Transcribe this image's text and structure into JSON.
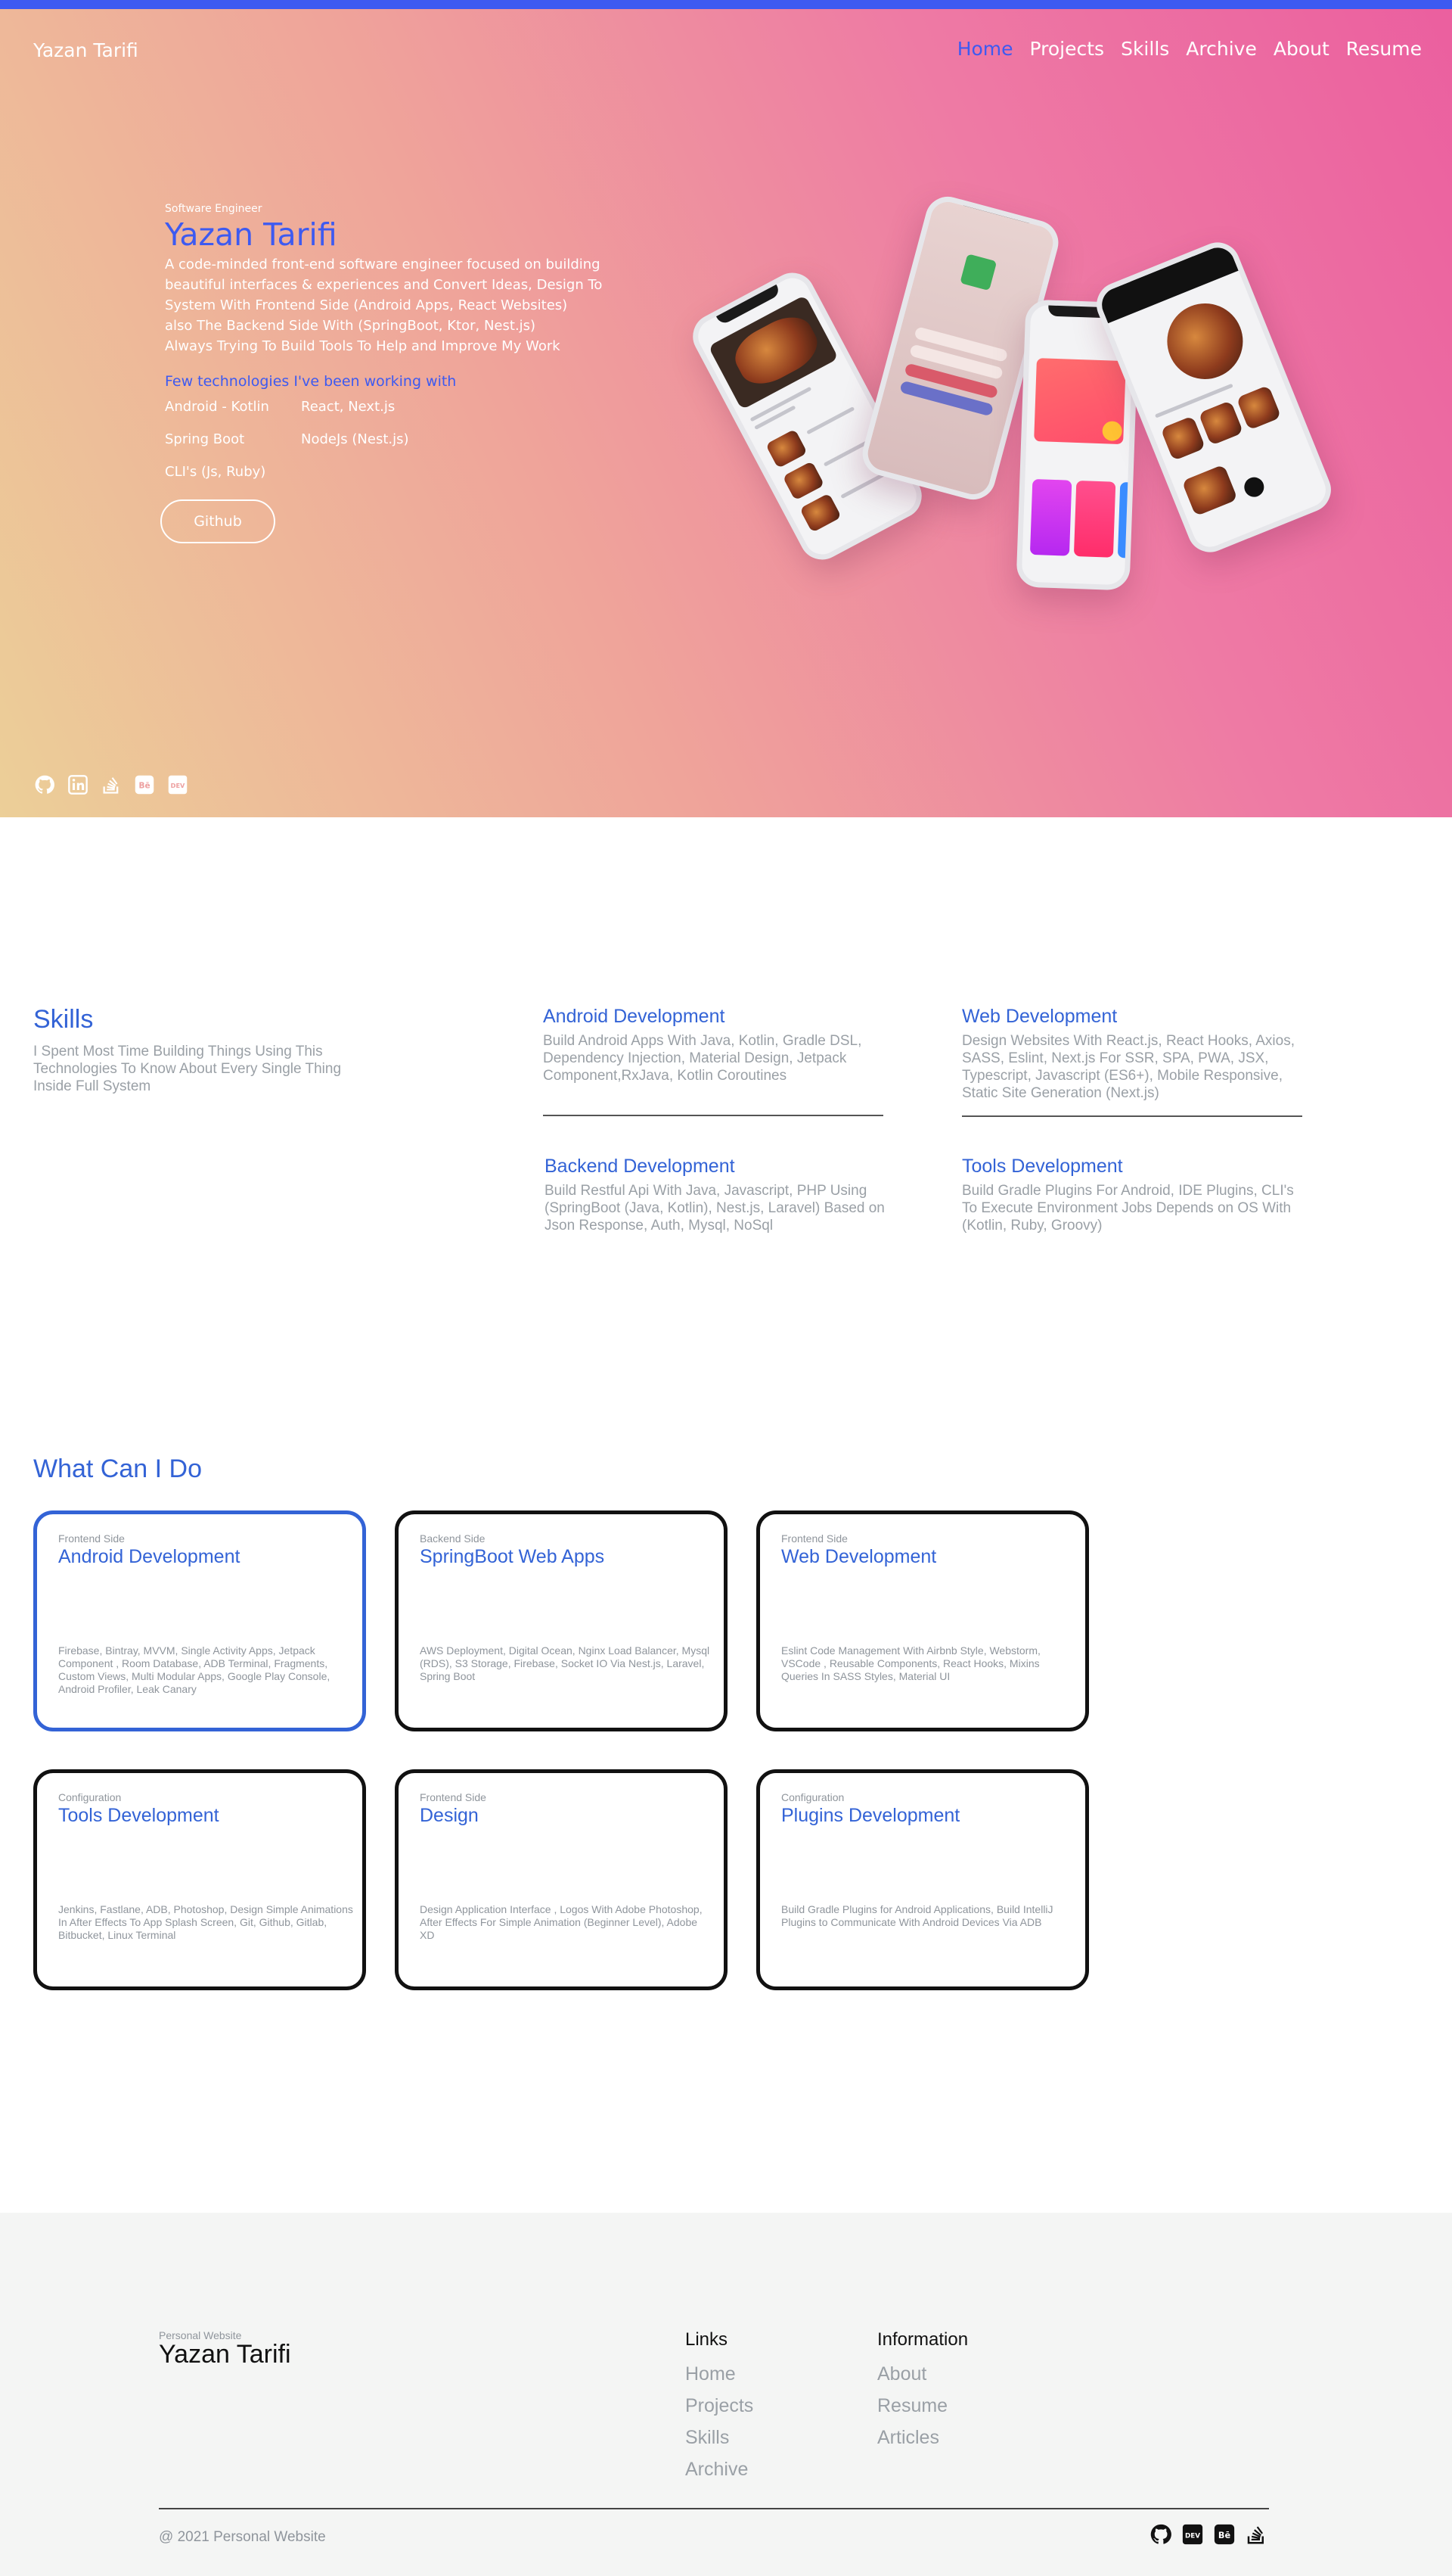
{
  "header": {
    "brand": "Yazan Tarifi",
    "nav": [
      {
        "label": "Home",
        "active": true
      },
      {
        "label": "Projects"
      },
      {
        "label": "Skills"
      },
      {
        "label": "Archive"
      },
      {
        "label": "About"
      },
      {
        "label": "Resume"
      }
    ],
    "accent_color": "#3d5af1"
  },
  "hero": {
    "role": "Software Engineer",
    "name": "Yazan Tarifi",
    "bio_lines": [
      "A code-minded front-end software engineer focused on building",
      "beautiful interfaces & experiences and Convert Ideas, Design To",
      "System With Frontend Side (Android Apps, React Websites)",
      "also The Backend Side With (SpringBoot, Ktor, Nest.js)",
      "Always Trying To Build Tools To Help and Improve My Work"
    ],
    "tech_title": "Few technologies I've been working with",
    "technologies": [
      "Android - Kotlin",
      "React, Next.js",
      "Spring Boot",
      "NodeJs (Nest.js)",
      "CLI's (Js, Ruby)"
    ],
    "github_button": "Github",
    "social_icons": [
      "github-icon",
      "linkedin-icon",
      "stackoverflow-icon",
      "behance-icon",
      "dev-icon"
    ]
  },
  "skills": {
    "title": "Skills",
    "description": "I Spent Most Time Building Things Using This Technologies To Know About Every Single Thing Inside Full System",
    "items": [
      {
        "title": "Android Development",
        "text": "Build Android Apps With Java, Kotlin, Gradle DSL, Dependency Injection, Material Design, Jetpack Component,RxJava, Kotlin Coroutines"
      },
      {
        "title": "Web Development",
        "text": "Design Websites With React.js, React Hooks, Axios, SASS, Eslint, Next.js For SSR, SPA, PWA, JSX, Typescript, Javascript (ES6+), Mobile Responsive, Static Site Generation (Next.js)"
      },
      {
        "title": "Backend Development",
        "text": "Build Restful Api With Java, Javascript, PHP Using (SpringBoot (Java, Kotlin), Nest.js, Laravel) Based on Json Response, Auth, Mysql, NoSql"
      },
      {
        "title": "Tools Development",
        "text": "Build Gradle Plugins For Android, IDE Plugins, CLI's To Execute Environment Jobs Depends on OS With (Kotlin, Ruby, Groovy)"
      }
    ]
  },
  "services": {
    "title": "What Can I Do",
    "cards": [
      {
        "category": "Frontend Side",
        "title": "Android Development",
        "text": "Firebase, Bintray, MVVM, Single Activity Apps, Jetpack Component , Room Database, ADB Terminal, Fragments, Custom Views, Multi Modular Apps, Google Play Console, Android Profiler, Leak Canary",
        "active": true
      },
      {
        "category": "Backend Side",
        "title": "SpringBoot Web Apps",
        "text": "AWS Deployment, Digital Ocean, Nginx Load Balancer, Mysql (RDS), S3 Storage, Firebase, Socket IO Via Nest.js, Laravel, Spring Boot"
      },
      {
        "category": "Frontend Side",
        "title": "Web Development",
        "text": "Eslint Code Management With Airbnb Style, Webstorm, VSCode , Reusable Components, React Hooks, Mixins Queries In SASS Styles, Material UI"
      },
      {
        "category": "Configuration",
        "title": "Tools Development",
        "text": "Jenkins, Fastlane, ADB, Photoshop, Design Simple Animations In After Effects To App Splash Screen, Git, Github, Gitlab, Bitbucket, Linux Terminal"
      },
      {
        "category": "Frontend Side",
        "title": "Design",
        "text": "Design Application Interface , Logos With Adobe Photoshop, After Effects For Simple Animation (Beginner Level), Adobe XD"
      },
      {
        "category": "Configuration",
        "title": "Plugins Development",
        "text": "Build Gradle Plugins for Android Applications, Build IntelliJ Plugins to Communicate With Android Devices Via ADB"
      }
    ]
  },
  "footer": {
    "label": "Personal Website",
    "name": "Yazan Tarifi",
    "links_title": "Links",
    "links": [
      "Home",
      "Projects",
      "Skills",
      "Archive"
    ],
    "info_title": "Information",
    "info": [
      "About",
      "Resume",
      "Articles"
    ],
    "copyright": "@ 2021 Personal Website",
    "social_icons": [
      "github-icon",
      "dev-icon",
      "behance-icon",
      "stackoverflow-icon"
    ]
  }
}
